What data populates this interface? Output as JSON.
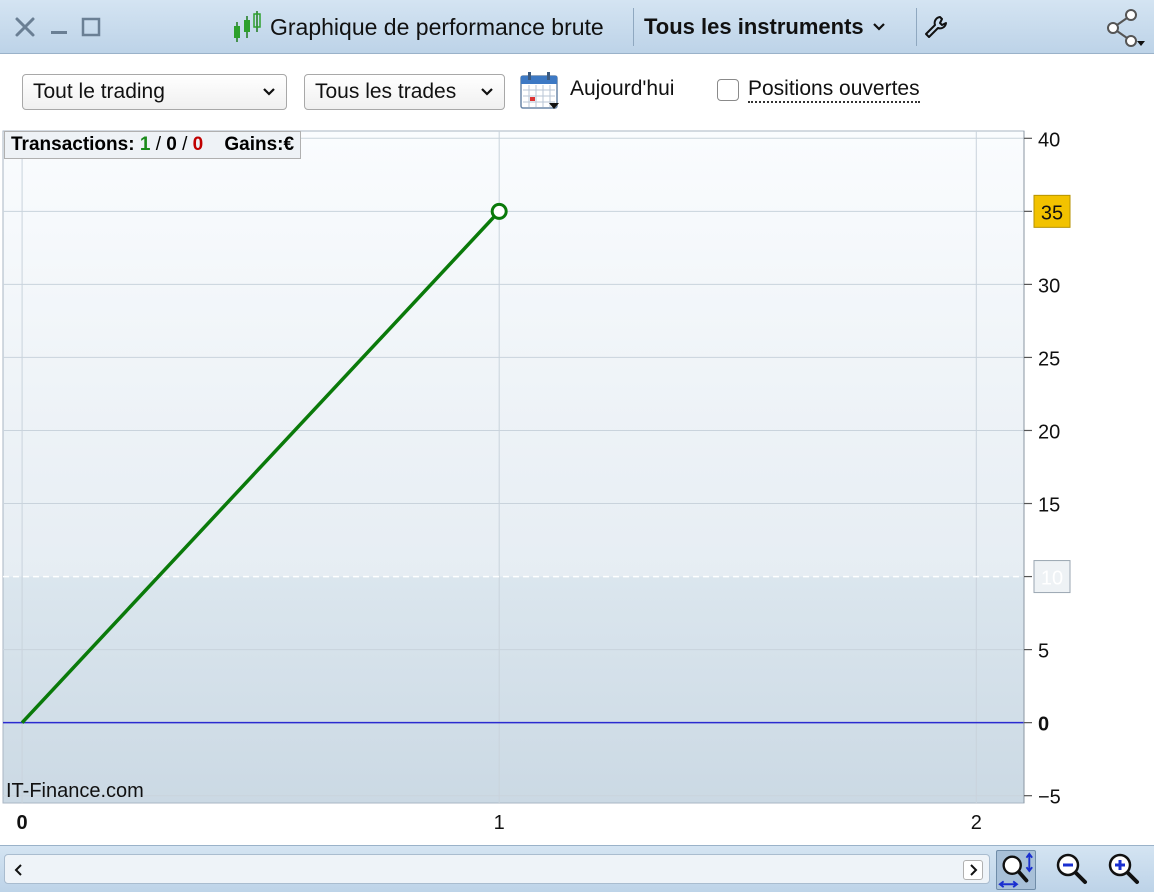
{
  "window": {
    "title": "Graphique de performance brute",
    "instrument_label": "Tous les instruments"
  },
  "toolbar": {
    "trading_select": "Tout le trading",
    "trades_select": "Tous les trades",
    "date_label": "Aujourd'hui",
    "open_positions_label": "Positions ouvertes",
    "open_positions_checked": false
  },
  "summary": {
    "transactions_label": "Transactions:",
    "won": "1",
    "neutral": "0",
    "lost": "0",
    "separator": "/",
    "gains_label": "Gains:",
    "currency": "€"
  },
  "watermark": "IT-Finance.com",
  "colors": {
    "series": "#0a7a0a",
    "zero_line": "#2a2ad0",
    "marker_badge": "#f2c200",
    "won": "#1a8a1a",
    "lost": "#c00000"
  },
  "chart_data": {
    "type": "line",
    "x": [
      0,
      1
    ],
    "y": [
      0,
      35
    ],
    "xlim": [
      -0.04,
      2.1
    ],
    "ylim": [
      -5.5,
      40.5
    ],
    "x_ticks": [
      0,
      1,
      2
    ],
    "y_ticks": [
      40,
      35,
      30,
      25,
      20,
      15,
      10,
      5,
      0,
      -5
    ],
    "last_value_badge": 35,
    "reference_value": 10,
    "zero_line": 0,
    "grid": true,
    "axis_position": "right"
  }
}
